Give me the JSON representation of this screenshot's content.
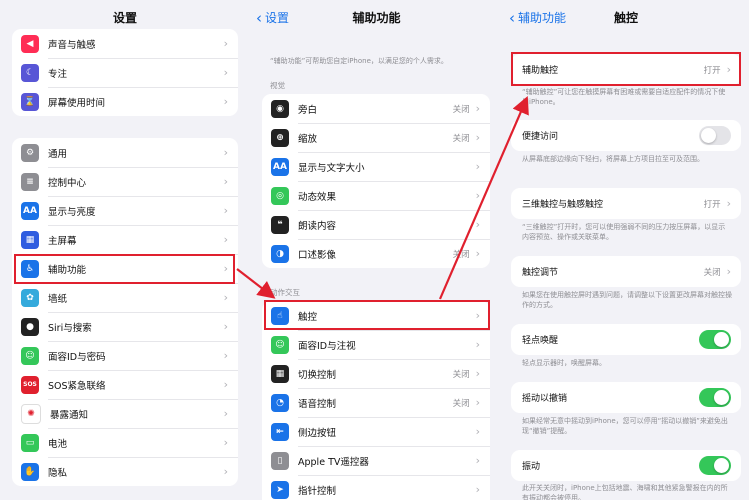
{
  "accent": "#1a73e8",
  "highlight_color": "#e0202e",
  "panel1": {
    "title": "设置",
    "group1": [
      {
        "label": "声音与触感",
        "icon": "speaker-icon",
        "color": "#ff2d55"
      },
      {
        "label": "专注",
        "icon": "moon-icon",
        "color": "#5856d6"
      },
      {
        "label": "屏幕使用时间",
        "icon": "hourglass-icon",
        "color": "#5856d6"
      }
    ],
    "group2": [
      {
        "label": "通用",
        "icon": "gear-icon",
        "color": "#8e8e93"
      },
      {
        "label": "控制中心",
        "icon": "switches-icon",
        "color": "#8e8e93"
      },
      {
        "label": "显示与亮度",
        "icon": "aa-icon",
        "color": "#1a73e8"
      },
      {
        "label": "主屏幕",
        "icon": "grid-icon",
        "color": "#2f5de0"
      },
      {
        "label": "辅助功能",
        "icon": "accessibility-icon",
        "color": "#1a73e8"
      },
      {
        "label": "墙纸",
        "icon": "flower-icon",
        "color": "#34aadc"
      },
      {
        "label": "Siri与搜索",
        "icon": "siri-icon",
        "color": "#222222"
      },
      {
        "label": "面容ID与密码",
        "icon": "faceid-icon",
        "color": "#34c759"
      },
      {
        "label": "SOS紧急联络",
        "icon": "sos-icon",
        "color": "#e0202e"
      },
      {
        "label": "暴露通知",
        "icon": "exposure-icon",
        "color": "#ffffff"
      },
      {
        "label": "电池",
        "icon": "battery-icon",
        "color": "#34c759"
      },
      {
        "label": "隐私",
        "icon": "hand-icon",
        "color": "#1a73e8"
      }
    ]
  },
  "panel2": {
    "back": "设置",
    "title": "辅助功能",
    "intro": "“辅助功能”可帮助您自定iPhone，以满足您的个人需求。",
    "section_vision": "视觉",
    "vision": [
      {
        "label": "旁白",
        "value": "关闭",
        "icon": "voiceover-icon",
        "color": "#222222"
      },
      {
        "label": "缩放",
        "value": "关闭",
        "icon": "zoom-icon",
        "color": "#222222"
      },
      {
        "label": "显示与文字大小",
        "value": "",
        "icon": "aa-icon",
        "color": "#1a73e8"
      },
      {
        "label": "动态效果",
        "value": "",
        "icon": "motion-icon",
        "color": "#34c759"
      },
      {
        "label": "朗读内容",
        "value": "",
        "icon": "speech-icon",
        "color": "#222222"
      },
      {
        "label": "口述影像",
        "value": "关闭",
        "icon": "audio-description-icon",
        "color": "#1a73e8"
      }
    ],
    "section_interaction": "动作交互",
    "interaction": [
      {
        "label": "触控",
        "value": "",
        "icon": "touch-icon",
        "color": "#1a73e8"
      },
      {
        "label": "面容ID与注视",
        "value": "",
        "icon": "faceid-icon",
        "color": "#34c759"
      },
      {
        "label": "切换控制",
        "value": "关闭",
        "icon": "switch-control-icon",
        "color": "#222222"
      },
      {
        "label": "语音控制",
        "value": "关闭",
        "icon": "voice-control-icon",
        "color": "#1a73e8"
      },
      {
        "label": "侧边按钮",
        "value": "",
        "icon": "side-button-icon",
        "color": "#1a73e8"
      },
      {
        "label": "Apple TV遥控器",
        "value": "",
        "icon": "remote-icon",
        "color": "#8e8e93"
      },
      {
        "label": "指针控制",
        "value": "",
        "icon": "pointer-icon",
        "color": "#1a73e8"
      }
    ]
  },
  "panel3": {
    "back": "辅助功能",
    "title": "触控",
    "assistive_touch": {
      "label": "辅助触控",
      "value": "打开",
      "desc": "“辅助触控”可让您在触摸屏幕有困难或需要自适应配件的情况下使用iPhone。"
    },
    "reachability": {
      "label": "便捷访问",
      "desc": "从屏幕底部边缘向下轻扫，将屏幕上方项目拉至可及范围。"
    },
    "haptic_touch": {
      "label": "三维触控与触感触控",
      "value": "打开",
      "desc": "“三维触控”打开时，您可以使用强弱不同的压力按压屏幕，以显示内容预览、操作或关联菜单。"
    },
    "touch_accommodations": {
      "label": "触控调节",
      "value": "关闭",
      "desc": "如果您在使用触控屏时遇到问题，请调整以下设置更改屏幕对触控操作的方式。"
    },
    "tap_to_wake": {
      "label": "轻点唤醒",
      "desc": "轻点显示器时，唤醒屏幕。"
    },
    "shake_to_undo": {
      "label": "摇动以撤销",
      "desc": "如果经常无意中摇动到iPhone，您可以停用“摇动以撤销”来避免出现“撤销”提醒。"
    },
    "vibration": {
      "label": "振动",
      "desc": "此开关关闭时，iPhone上包括地震、海啸和其他紧急警报在内的所有振动都会被停用。"
    }
  }
}
